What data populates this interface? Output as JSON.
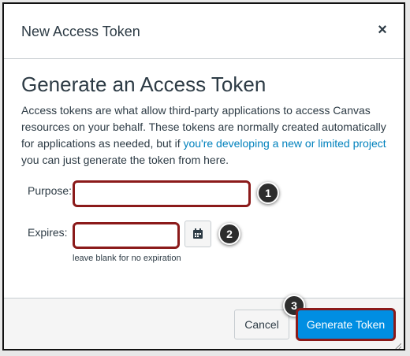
{
  "dialog": {
    "title": "New Access Token",
    "close_symbol": "×"
  },
  "form": {
    "heading": "Generate an Access Token",
    "description_before_link": "Access tokens are what allow third-party applications to access Canvas resources on your behalf. These tokens are normally created automatically for applications as needed, but if ",
    "description_link": "you're developing a new or limited project",
    "description_after_link": " you can just generate the token from here.",
    "purpose_label": "Purpose:",
    "purpose_value": "",
    "expires_label": "Expires:",
    "expires_value": "",
    "expires_hint": "leave blank for no expiration"
  },
  "callouts": [
    "1",
    "2",
    "3"
  ],
  "footer": {
    "cancel_label": "Cancel",
    "generate_label": "Generate Token"
  },
  "colors": {
    "link": "#0081bd",
    "primary": "#008ee2",
    "highlight": "#8b1a1a",
    "text": "#2d3b45"
  },
  "icons": {
    "close": "close-icon",
    "calendar": "calendar-icon"
  }
}
